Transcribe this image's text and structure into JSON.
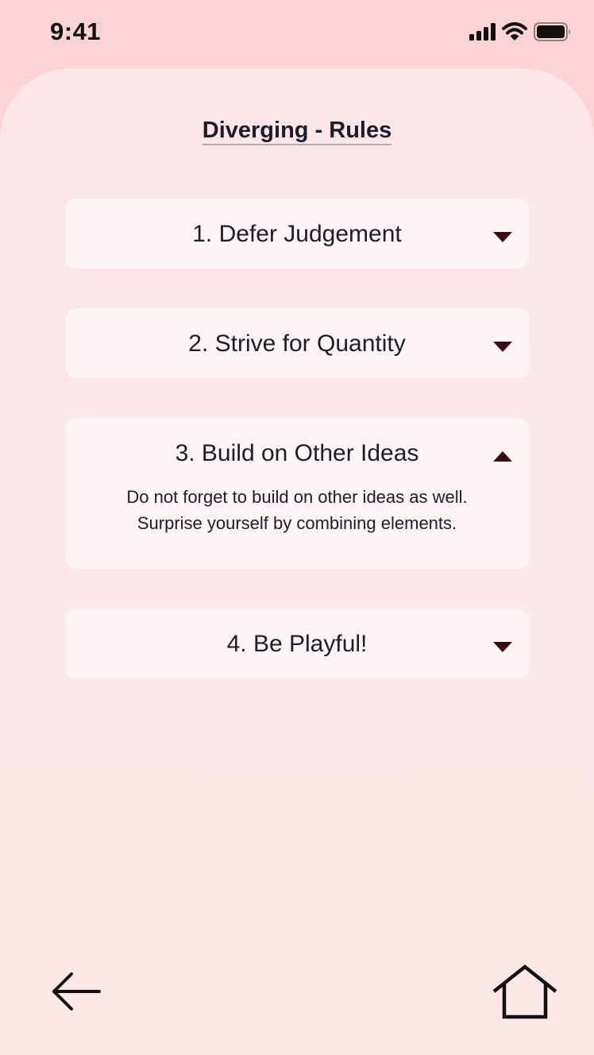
{
  "status_bar": {
    "time": "9:41",
    "icons": [
      "cellular-signal-icon",
      "wifi-icon",
      "battery-icon"
    ]
  },
  "page": {
    "title": "Diverging - Rules"
  },
  "rules": [
    {
      "title": "1. Defer Judgement",
      "expanded": false
    },
    {
      "title": "2. Strive for Quantity",
      "expanded": false
    },
    {
      "title": "3. Build on Other Ideas",
      "expanded": true,
      "description_lines": [
        "Do not forget to build on other ideas as well.",
        "Surprise yourself by combining elements."
      ]
    },
    {
      "title": "4. Be Playful!",
      "expanded": false
    }
  ],
  "navigation": {
    "back_icon": "arrow-left-icon",
    "home_icon": "home-icon"
  },
  "colors": {
    "header_background": "#fdd3d5",
    "sheet_background": "#fde6e7",
    "card_background": "#fdf5f5",
    "text": "#1c1c2b",
    "caret": "#3a0b14"
  }
}
